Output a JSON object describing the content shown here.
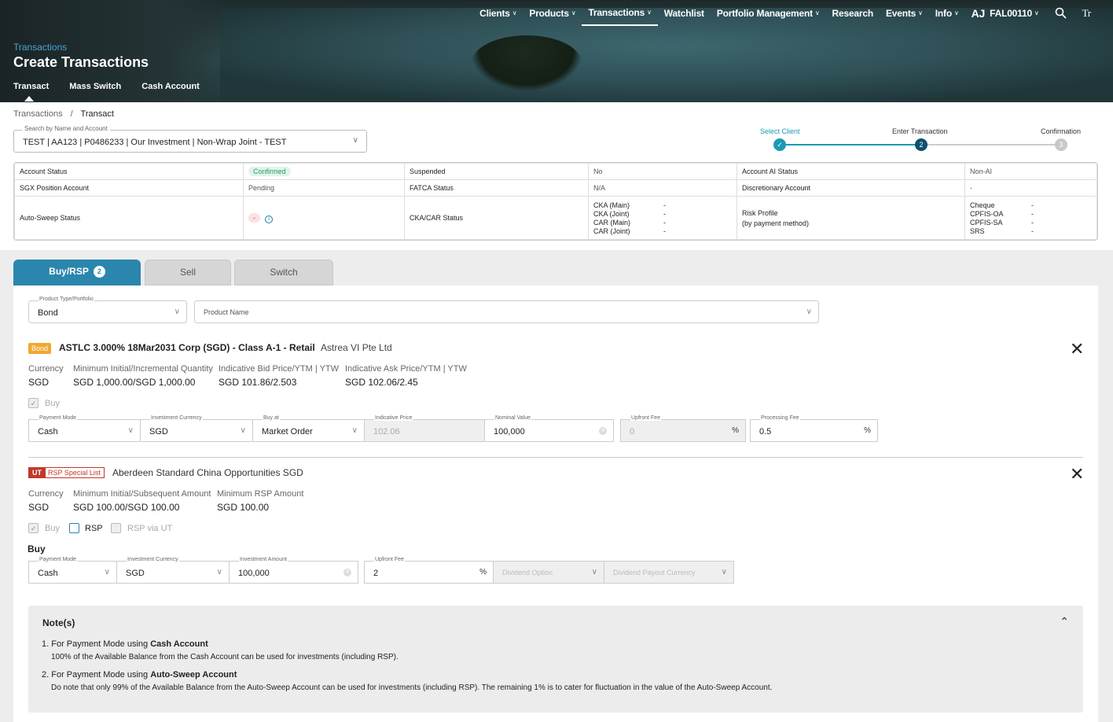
{
  "nav": {
    "items": [
      {
        "label": "Clients",
        "chevron": true
      },
      {
        "label": "Products",
        "chevron": true
      },
      {
        "label": "Transactions",
        "chevron": true,
        "active": true
      },
      {
        "label": "Watchlist",
        "chevron": false
      },
      {
        "label": "Portfolio Management",
        "chevron": true
      },
      {
        "label": "Research",
        "chevron": false
      },
      {
        "label": "Events",
        "chevron": true
      },
      {
        "label": "Info",
        "chevron": true
      }
    ],
    "avatar_initials": "AJ",
    "user": "FAL00110",
    "search_icon": "search-icon",
    "font_icon_text": "Tr"
  },
  "header": {
    "subtitle": "Transactions",
    "title": "Create Transactions",
    "tabs": [
      "Transact",
      "Mass Switch",
      "Cash Account"
    ]
  },
  "breadcrumb": {
    "root": "Transactions",
    "sep": "/",
    "current": "Transact"
  },
  "search": {
    "label": "Search by Name and Account",
    "value": "TEST | AA123 | P0486233 | Our Investment | Non-Wrap Joint - TEST"
  },
  "stepper": {
    "steps": [
      {
        "label": "Select Client",
        "state": "done"
      },
      {
        "label": "Enter Transaction",
        "state": "current",
        "num": "2"
      },
      {
        "label": "Confirmation",
        "state": "pending",
        "num": "3"
      }
    ],
    "colors": {
      "done": "#1a9bb3",
      "current": "#0f4f6e",
      "pending": "#c8c8c8"
    }
  },
  "account": {
    "account_status_label": "Account Status",
    "account_status": "Confirmed",
    "suspended_label": "Suspended",
    "suspended": "No",
    "ai_label": "Account AI Status",
    "ai": "Non-AI",
    "sgx_label": "SGX Position Account",
    "sgx": "Pending",
    "fatca_label": "FATCA Status",
    "fatca": "N/A",
    "disc_label": "Discretionary Account",
    "disc": "-",
    "sweep_label": "Auto-Sweep Status",
    "sweep": "-",
    "cka_label": "CKA/CAR Status",
    "cka": [
      {
        "k": "CKA (Main)",
        "v": "-"
      },
      {
        "k": "CKA (Joint)",
        "v": "-"
      },
      {
        "k": "CAR (Main)",
        "v": "-"
      },
      {
        "k": "CAR (Joint)",
        "v": "-"
      }
    ],
    "risk_label1": "Risk Profile",
    "risk_label2": "(by payment method)",
    "risk": [
      {
        "k": "Cheque",
        "v": "-"
      },
      {
        "k": "CPFIS-OA",
        "v": "-"
      },
      {
        "k": "CPFIS-SA",
        "v": "-"
      },
      {
        "k": "SRS",
        "v": "-"
      }
    ]
  },
  "tabs": {
    "buy": "Buy/RSP",
    "buy_count": "2",
    "sell": "Sell",
    "switch": "Switch"
  },
  "filters": {
    "type_label": "Product Type/Portfolio",
    "type_value": "Bond",
    "name_label": "Product Name"
  },
  "bond": {
    "tag": "Bond",
    "name": "ASTLC 3.000% 18Mar2031 Corp (SGD) - Class A-1 - Retail",
    "issuer": "Astrea VI Pte Ltd",
    "currency_h": "Currency",
    "currency": "SGD",
    "minq_h": "Minimum Initial/Incremental Quantity",
    "minq": "SGD 1,000.00/SGD 1,000.00",
    "bid_h": "Indicative Bid Price/YTM | YTW",
    "bid": "SGD 101.86/2.503",
    "ask_h": "Indicative Ask Price/YTM | YTW",
    "ask": "SGD 102.06/2.45",
    "buy_label": "Buy",
    "fields": {
      "pm_l": "Payment Mode",
      "pm": "Cash",
      "ic_l": "Investment Currency",
      "ic": "SGD",
      "ba_l": "Buy at",
      "ba": "Market Order",
      "ip_l": "Indicative Price",
      "ip": "102.06",
      "nv_l": "Nominal Value",
      "nv": "100,000",
      "uf_l": "Upfront Fee",
      "uf": "0",
      "pct": "%",
      "pf_l": "Processing Fee",
      "pf": "0.5"
    }
  },
  "ut": {
    "tag": "UT",
    "tag2": "RSP Special List",
    "name": "Aberdeen Standard China Opportunities SGD",
    "currency_h": "Currency",
    "currency": "SGD",
    "mins_h": "Minimum Initial/Subsequent Amount",
    "mins": "SGD 100.00/SGD 100.00",
    "rsp_h": "Minimum RSP Amount",
    "rsp": "SGD 100.00",
    "cb_buy": "Buy",
    "cb_rsp": "RSP",
    "cb_rspvia": "RSP via UT",
    "section": "Buy",
    "fields": {
      "pm_l": "Payment Mode",
      "pm": "Cash",
      "ic_l": "Investment Currency",
      "ic": "SGD",
      "ia_l": "Investment Amount",
      "ia": "100,000",
      "uf_l": "Upfront Fee",
      "uf": "2",
      "pct": "%",
      "do": "Dividend Option",
      "dpc": "Dividend Payout Currency"
    }
  },
  "notes": {
    "title": "Note(s)",
    "n1_pre": "1. For Payment Mode using ",
    "n1_b": "Cash Account",
    "n1_d": "100% of the Available Balance from the Cash Account can be used for investments (including RSP).",
    "n2_pre": "2. For Payment Mode using ",
    "n2_b": "Auto-Sweep Account",
    "n2_d": "Do note that only 99% of the Available Balance from the Auto-Sweep Account can be used for investments (including RSP). The remaining 1% is to cater for fluctuation in the value of the Auto-Sweep Account."
  }
}
